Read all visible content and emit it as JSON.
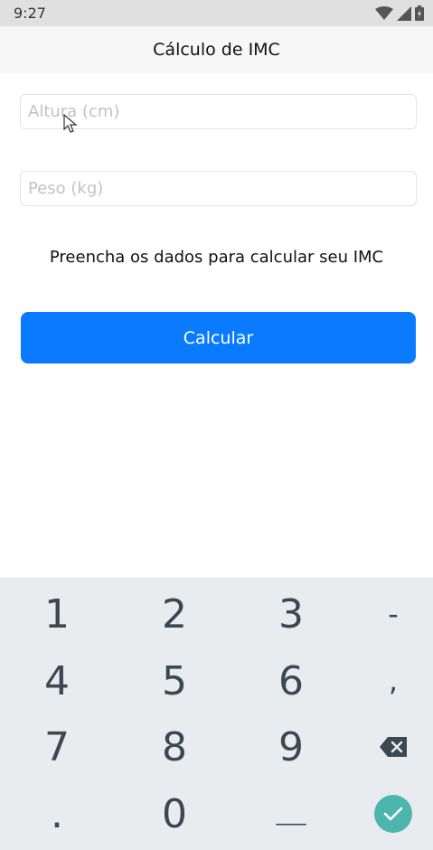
{
  "status_bar": {
    "time": "9:27"
  },
  "app_bar": {
    "title": "Cálculo de IMC"
  },
  "form": {
    "altura": {
      "value": "",
      "placeholder": "Altura (cm)"
    },
    "peso": {
      "value": "",
      "placeholder": "Peso (kg)"
    },
    "message": "Preencha os dados para calcular seu IMC",
    "button_label": "Calcular"
  },
  "keyboard": {
    "keys": {
      "k1": "1",
      "k2": "2",
      "k3": "3",
      "minus": "-",
      "k4": "4",
      "k5": "5",
      "k6": "6",
      "comma": ",",
      "k7": "7",
      "k8": "8",
      "k9": "9",
      "dot": ".",
      "k0": "0",
      "space": "___"
    },
    "backspace_icon": "backspace-icon",
    "enter_icon": "check-icon",
    "enter_color": "#4db6ac"
  },
  "colors": {
    "accent": "#0a7bff"
  }
}
